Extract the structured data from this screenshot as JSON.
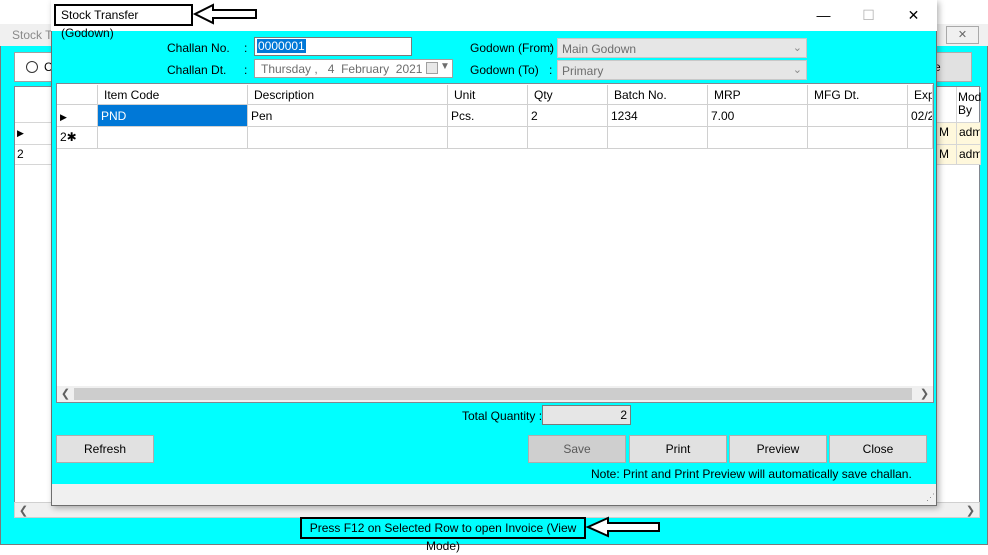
{
  "background_window": {
    "title": "Stock T",
    "close_label": "✕",
    "radio_label": "C",
    "right_button_label": "e",
    "header": {
      "col1": "Mod",
      "col1b": "By"
    },
    "rows": [
      {
        "num": "",
        "c1": "M",
        "c2": "admi"
      },
      {
        "num": "2",
        "c1": "M",
        "c2": "admi"
      }
    ],
    "status_text": "Press F12 on Selected Row to open Invoice (View Mode)"
  },
  "dialog": {
    "title": "Stock Transfer (Godown)",
    "minimize_glyph": "—",
    "maximize_glyph": "☐",
    "close_glyph": "✕",
    "challan_no_label": "Challan No.",
    "challan_no_value": "0000001",
    "challan_dt_label": "Challan Dt.",
    "challan_dt": {
      "day": "Thursday",
      "date": "4",
      "month": "February",
      "year": "2021"
    },
    "godown_from_label": "Godown (From)",
    "godown_from_value": "Main Godown",
    "godown_to_label": "Godown (To)",
    "godown_to_value": "Primary",
    "colon": ":",
    "grid": {
      "columns": [
        "Item Code",
        "Description",
        "Unit",
        "Qty",
        "Batch No.",
        "MRP",
        "MFG Dt.",
        "Exp"
      ],
      "rows": [
        {
          "item_code": "PND",
          "description": "Pen",
          "unit": "Pcs.",
          "qty": "2",
          "batch_no": "1234",
          "mrp": "7.00",
          "mfg_dt": "",
          "exp": "02/2"
        }
      ]
    },
    "total_quantity_label": "Total Quantity :",
    "total_quantity_value": "2",
    "buttons": {
      "refresh": "Refresh",
      "save": "Save",
      "print": "Print",
      "preview": "Preview",
      "close": "Close"
    },
    "note": "Note: Print and Print Preview will automatically save challan."
  },
  "colors": {
    "dialog_bg": "#00ffff",
    "selection": "#0078d7"
  }
}
